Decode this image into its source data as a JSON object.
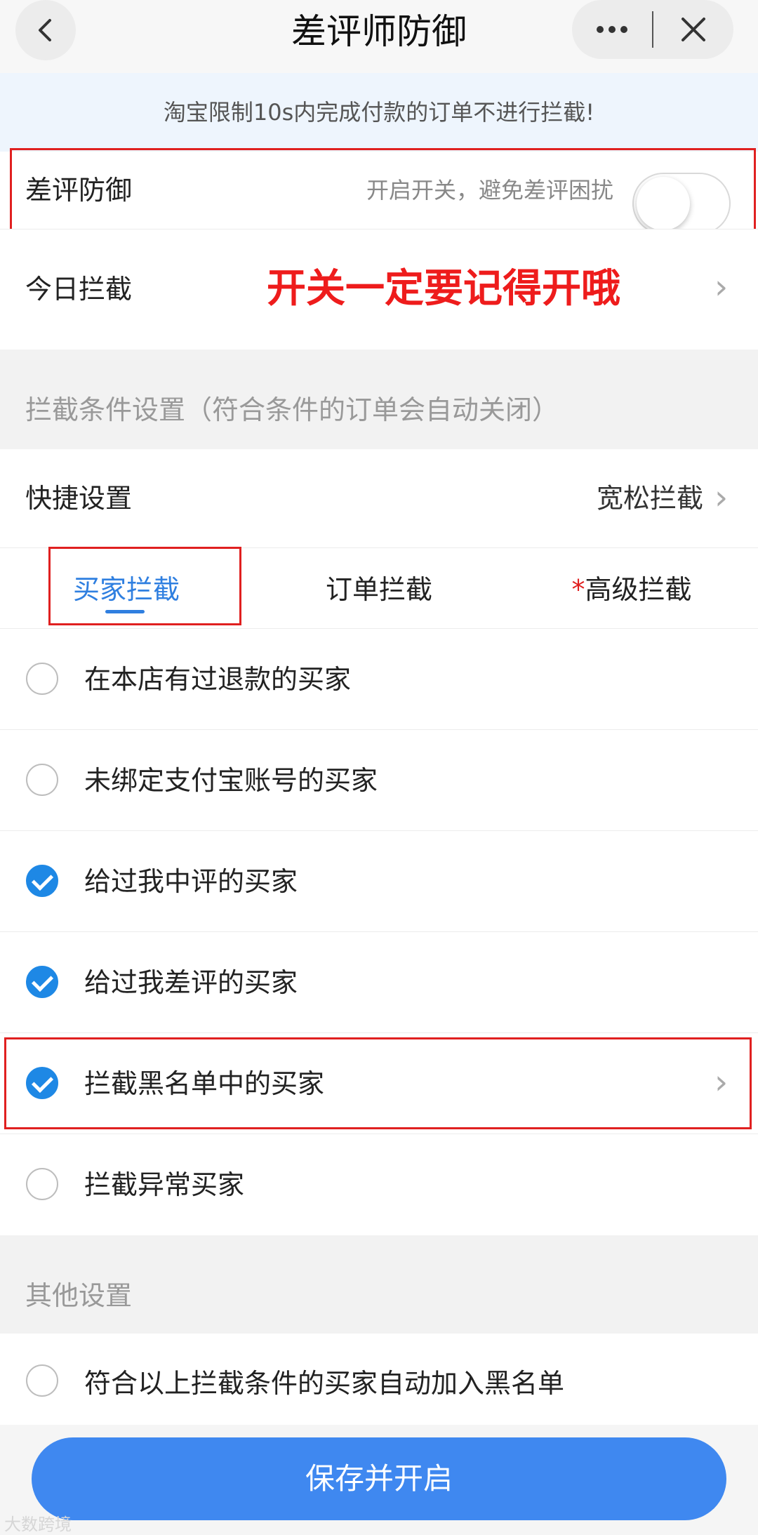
{
  "header": {
    "title": "差评师防御",
    "back_icon": "chevron-left-icon",
    "more_icon": "more-horizontal-icon",
    "close_icon": "close-icon"
  },
  "notice": "淘宝限制10s内完成付款的订单不进行拦截!",
  "defense": {
    "label": "差评防御",
    "hint": "开启开关，避免差评困扰",
    "toggle_on": false
  },
  "today": {
    "label": "今日拦截",
    "annotation": "开关一定要记得开哦"
  },
  "conditions_section": {
    "title": "拦截条件设置（符合条件的订单会自动关闭）"
  },
  "quick": {
    "label": "快捷设置",
    "value": "宽松拦截"
  },
  "tabs": [
    {
      "label": "买家拦截",
      "prefix": "",
      "active": true
    },
    {
      "label": "订单拦截",
      "prefix": "",
      "active": false
    },
    {
      "label": "高级拦截",
      "prefix": "*",
      "active": false
    }
  ],
  "options": [
    {
      "label": "在本店有过退款的买家",
      "checked": false
    },
    {
      "label": "未绑定支付宝账号的买家",
      "checked": false
    },
    {
      "label": "给过我中评的买家",
      "checked": true
    },
    {
      "label": "给过我差评的买家",
      "checked": true
    },
    {
      "label": "拦截黑名单中的买家",
      "checked": true
    },
    {
      "label": "拦截异常买家",
      "checked": false
    }
  ],
  "other_section": {
    "title": "其他设置",
    "option_label": "符合以上拦截条件的买家自动加入黑名单",
    "option_checked": false
  },
  "save_button": "保存并开启",
  "watermark": "大数跨境",
  "colors": {
    "accent": "#3f88f0",
    "tab_active": "#2f7fe0",
    "checked": "#1e88e5",
    "annotation_red": "#ee1c1c"
  }
}
